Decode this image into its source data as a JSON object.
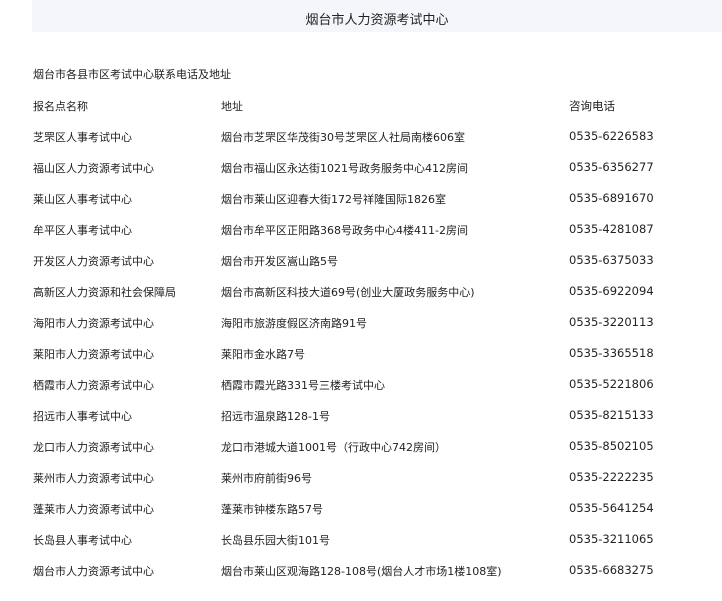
{
  "header": {
    "title": "烟台市人力资源考试中心"
  },
  "section": {
    "title": "烟台市各县市区考试中心联系电话及地址"
  },
  "table": {
    "columns": [
      "报名点名称",
      "地址",
      "咨询电话"
    ],
    "rows": [
      {
        "name": "芝罘区人事考试中心",
        "address": "烟台市芝罘区华茂街30号芝罘区人社局南楼606室",
        "phone": "0535-6226583"
      },
      {
        "name": "福山区人力资源考试中心",
        "address": "烟台市福山区永达街1021号政务服务中心412房间",
        "phone": "0535-6356277"
      },
      {
        "name": "莱山区人事考试中心",
        "address": "烟台市莱山区迎春大街172号祥隆国际1826室",
        "phone": "0535-6891670"
      },
      {
        "name": "牟平区人事考试中心",
        "address": "烟台市牟平区正阳路368号政务中心4楼411-2房间",
        "phone": "0535-4281087"
      },
      {
        "name": "开发区人力资源考试中心",
        "address": "烟台市开发区嵩山路5号",
        "phone": "0535-6375033"
      },
      {
        "name": "高新区人力资源和社会保障局",
        "address": "烟台市高新区科技大道69号(创业大厦政务服务中心)",
        "phone": "0535-6922094"
      },
      {
        "name": "海阳市人力资源考试中心",
        "address": "海阳市旅游度假区济南路91号",
        "phone": "0535-3220113"
      },
      {
        "name": "莱阳市人力资源考试中心",
        "address": "莱阳市金水路7号",
        "phone": "0535-3365518"
      },
      {
        "name": "栖霞市人力资源考试中心",
        "address": "栖霞市霞光路331号三楼考试中心",
        "phone": "0535-5221806"
      },
      {
        "name": "招远市人事考试中心",
        "address": "招远市温泉路128-1号",
        "phone": "0535-8215133"
      },
      {
        "name": "龙口市人力资源考试中心",
        "address": "龙口市港城大道1001号（行政中心742房间）",
        "phone": "0535-8502105"
      },
      {
        "name": "莱州市人力资源考试中心",
        "address": "莱州市府前街96号",
        "phone": "0535-2222235"
      },
      {
        "name": "蓬莱市人力资源考试中心",
        "address": "蓬莱市钟楼东路57号",
        "phone": "0535-5641254"
      },
      {
        "name": "长岛县人事考试中心",
        "address": "长岛县乐园大街101号",
        "phone": "0535-3211065"
      },
      {
        "name": "烟台市人力资源考试中心",
        "address": "烟台市莱山区观海路128-108号(烟台人才市场1楼108室)",
        "phone": "0535-6683275"
      }
    ]
  }
}
